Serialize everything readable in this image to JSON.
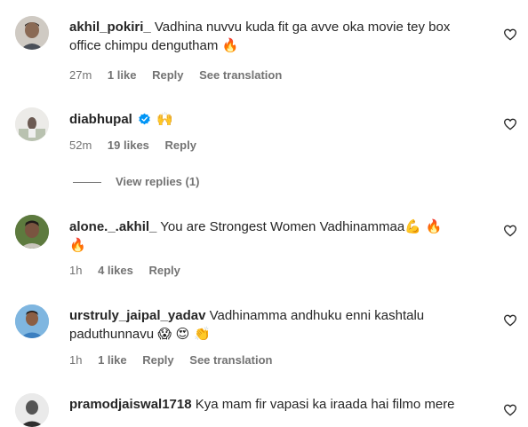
{
  "comments": [
    {
      "username": "akhil_pokiri_",
      "text_line1": "Vadhina nuvvu kuda fit ga avve oka movie tey box",
      "text_line2": "office chimpu dengutham",
      "emoji_end": "🔥",
      "time": "27m",
      "likes": "1 like",
      "reply": "Reply",
      "translation": "See translation"
    },
    {
      "username": "diabhupal",
      "verified": true,
      "emoji_text": "🙌",
      "time": "52m",
      "likes": "19 likes",
      "reply": "Reply",
      "view_replies": "View replies (1)"
    },
    {
      "username": "alone._.akhil_",
      "text_line1": "You are Strongest Women Vadhinammaa",
      "emoji_line1": "💪 🔥",
      "emoji_line2": "🔥",
      "time": "1h",
      "likes": "4 likes",
      "reply": "Reply"
    },
    {
      "username": "urstruly_jaipal_yadav",
      "text_line1": "Vadhinamma andhuku enni kashtalu",
      "text_line2": "paduthunnavu",
      "emoji_line2": "😱 😍 👏",
      "time": "1h",
      "likes": "1 like",
      "reply": "Reply",
      "translation": "See translation"
    },
    {
      "username": "pramodjaiswal1718",
      "text_line1": "Kya mam fir vapasi ka iraada hai filmo mere"
    }
  ],
  "colors": {
    "text": "#262626",
    "secondary": "#737373",
    "verified": "#0095f6"
  }
}
